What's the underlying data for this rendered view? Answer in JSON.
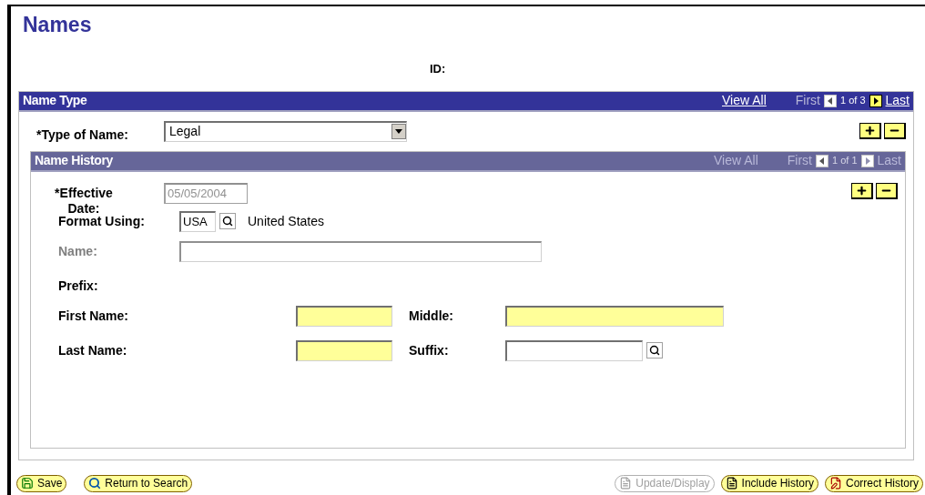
{
  "title": "Names",
  "id_label": "ID:",
  "name_type": {
    "title": "Name Type",
    "view_all": {
      "label": "View All",
      "disabled": false
    },
    "first": {
      "label": "First",
      "disabled": true
    },
    "prev_disabled": true,
    "count": "1 of 3",
    "next_disabled": false,
    "last": {
      "label": "Last",
      "disabled": false
    },
    "type_of_name": {
      "label": "*Type of Name:",
      "value": "Legal"
    }
  },
  "name_history": {
    "title": "Name History",
    "view_all": {
      "label": "View All",
      "disabled": true
    },
    "first": {
      "label": "First",
      "disabled": true
    },
    "prev_disabled": true,
    "count": "1 of 1",
    "next_disabled": true,
    "last": {
      "label": "Last",
      "disabled": true
    },
    "effective_date": {
      "label": "*Effective Date:",
      "value": "05/05/2004",
      "disabled": true
    },
    "format_using": {
      "label": "Format Using:",
      "value": "USA",
      "description": "United States"
    },
    "name": {
      "label": "Name:",
      "disabled": true
    },
    "prefix": {
      "label": "Prefix:"
    },
    "first_name": {
      "label": "First Name:",
      "required": true
    },
    "middle": {
      "label": "Middle:",
      "required": true
    },
    "last_name": {
      "label": "Last Name:",
      "required": true
    },
    "suffix": {
      "label": "Suffix:",
      "required": false
    }
  },
  "left_buttons": [
    {
      "kind": "save",
      "label": "Save",
      "disabled": false
    },
    {
      "kind": "search",
      "label": "Return to Search",
      "disabled": false
    }
  ],
  "right_buttons": [
    {
      "kind": "update",
      "label": "Update/Display",
      "disabled": true
    },
    {
      "kind": "include",
      "label": "Include History",
      "disabled": false
    },
    {
      "kind": "correct",
      "label": "Correct History",
      "disabled": false
    }
  ]
}
